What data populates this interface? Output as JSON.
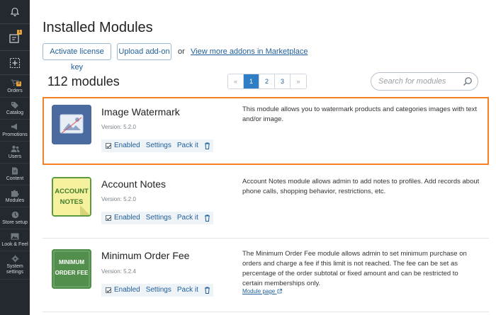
{
  "sidebar": {
    "orders_badge_top": "1",
    "items": [
      {
        "label": "Orders",
        "icon": "cart-icon",
        "badge": "9"
      },
      {
        "label": "Catalog",
        "icon": "tag-icon"
      },
      {
        "label": "Promotions",
        "icon": "megaphone-icon"
      },
      {
        "label": "Users",
        "icon": "users-icon"
      },
      {
        "label": "Content",
        "icon": "file-icon"
      },
      {
        "label": "Modules",
        "icon": "puzzle-icon"
      },
      {
        "label": "Store setup",
        "icon": "store-icon"
      },
      {
        "label": "Look & Feel",
        "icon": "image-icon"
      },
      {
        "label": "System settings",
        "icon": "gear-icon"
      }
    ]
  },
  "header": {
    "title": "Installed Modules",
    "activate_label": "Activate license key",
    "upload_label": "Upload add-on",
    "or_text": "or",
    "marketplace_link": "View more addons in Marketplace"
  },
  "list": {
    "count": "112 modules",
    "pagination": [
      "«",
      "1",
      "2",
      "3",
      "»"
    ],
    "current_page": "1",
    "search_placeholder": "Search for modules"
  },
  "modules": [
    {
      "name": "Image Watermark",
      "version": "Version: 5.2.0",
      "enabled_label": "Enabled",
      "settings_label": "Settings",
      "packit_label": "Pack it",
      "description": "This module allows you to watermark products and categories images with text and/or image.",
      "icon_text": "",
      "selected": true
    },
    {
      "name": "Account Notes",
      "version": "Version: 5.2.0",
      "enabled_label": "Enabled",
      "settings_label": "Settings",
      "packit_label": "Pack it",
      "description": "Account Notes module allows admin to add notes to profiles. Add records about phone calls, shopping behavior, restrictions, etc.",
      "icon_text_1": "ACCOUNT",
      "icon_text_2": "NOTES"
    },
    {
      "name": "Minimum Order Fee",
      "version": "Version: 5.2.4",
      "enabled_label": "Enabled",
      "settings_label": "Settings",
      "packit_label": "Pack it",
      "description": "The Minimum Order Fee module allows admin to set minimum purchase on orders and charge a fee if this limit is not reached. The fee can be set as percentage of the order subtotal or fixed amount and can be restricted to certain memberships only.",
      "link": "Module page",
      "icon_text_1": "MINIMUM",
      "icon_text_2": "ORDER FEE"
    }
  ],
  "colors": {
    "sidebar_bg": "#24292f",
    "accent": "#2d7ec6",
    "selection_border": "#f38025",
    "link": "#1f5e99"
  }
}
